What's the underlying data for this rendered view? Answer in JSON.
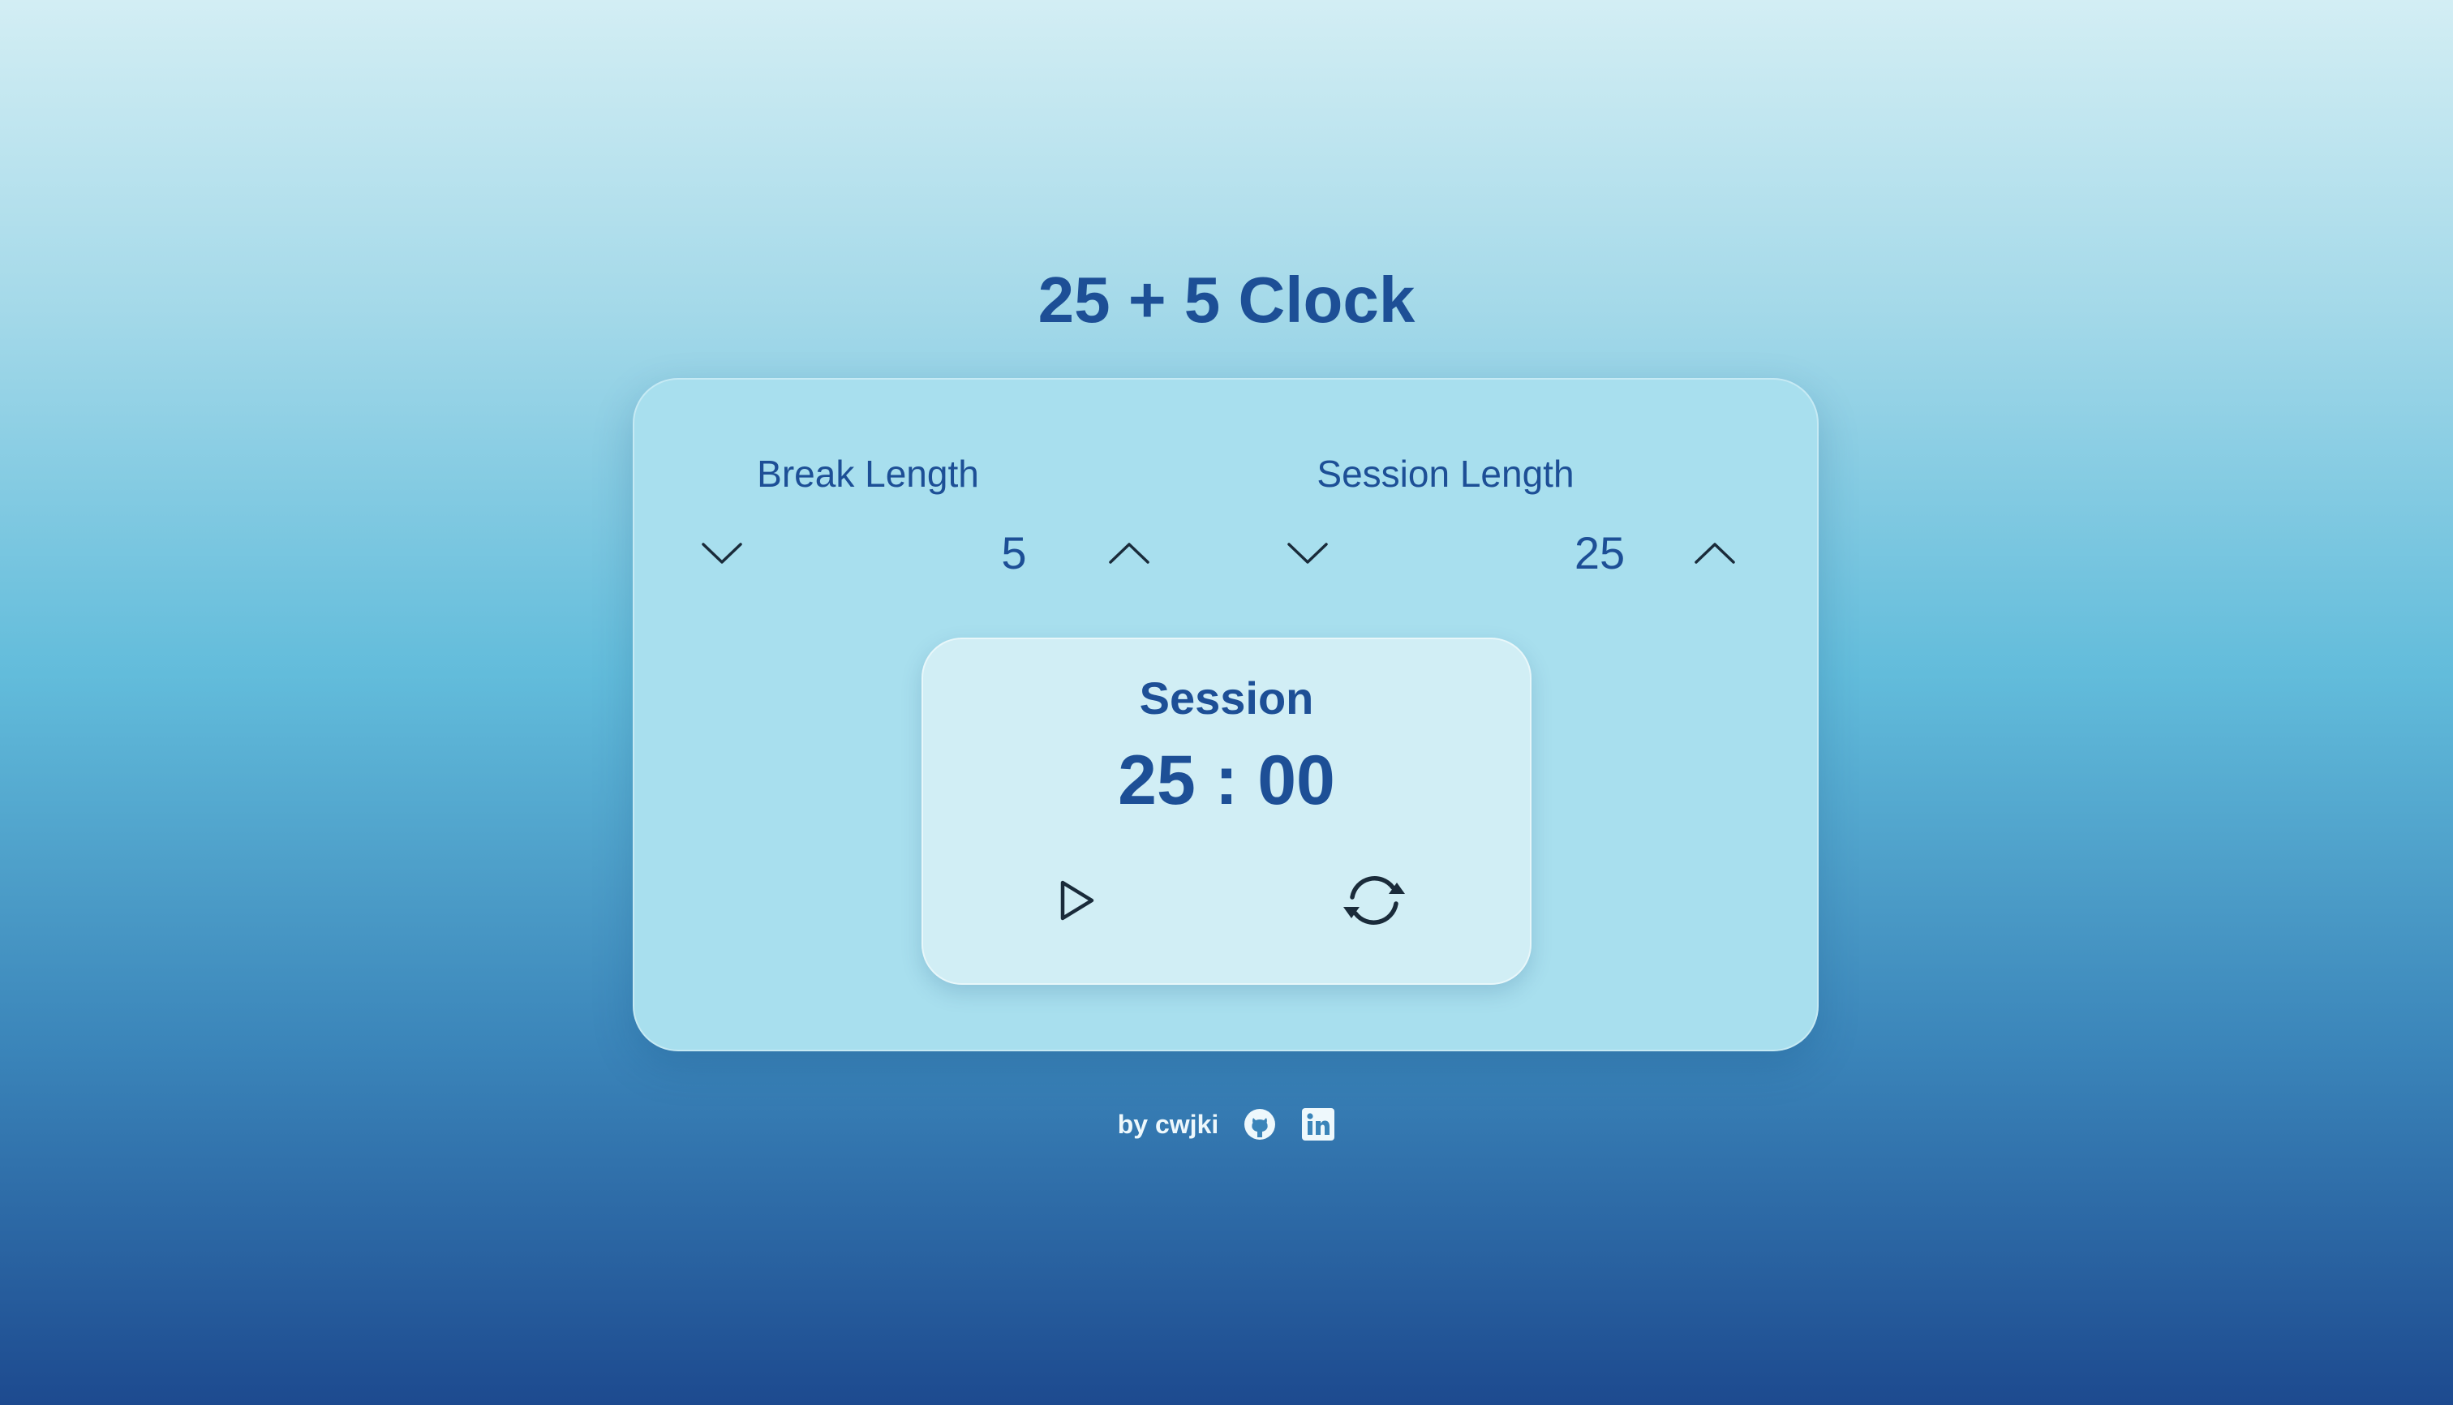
{
  "app": {
    "title": "25 + 5 Clock"
  },
  "break": {
    "label": "Break Length",
    "value": "5",
    "decrement_icon": "chevron-down-icon",
    "increment_icon": "chevron-up-icon"
  },
  "session": {
    "label": "Session Length",
    "value": "25",
    "decrement_icon": "chevron-down-icon",
    "increment_icon": "chevron-up-icon"
  },
  "timer": {
    "label": "Session",
    "time": "25 : 00",
    "play_icon": "play-icon",
    "reset_icon": "refresh-icon"
  },
  "footer": {
    "author": "by cwjki",
    "links": [
      "github-icon",
      "linkedin-icon"
    ]
  },
  "colors": {
    "accent": "#1d4f96",
    "panel": "#a8dfee",
    "timer_card": "#d1eef5",
    "footer_text": "#eef8fc",
    "icon_dark": "#1a2b3a"
  }
}
